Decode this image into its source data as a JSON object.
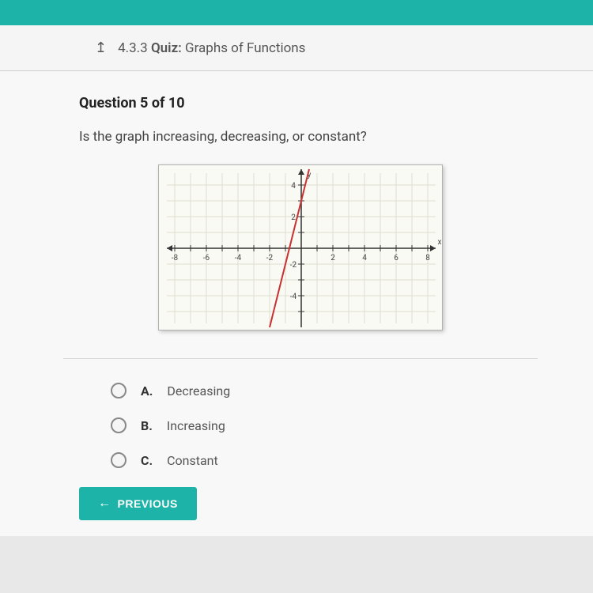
{
  "header": {
    "section_number": "4.3.3",
    "quiz_label": "Quiz:",
    "quiz_title": "Graphs of Functions"
  },
  "question": {
    "number_label": "Question 5 of 10",
    "text": "Is the graph increasing, decreasing, or constant?"
  },
  "chart_data": {
    "type": "line",
    "x": [
      -2,
      0.5
    ],
    "y": [
      -5,
      5
    ],
    "title": "",
    "xlabel": "x",
    "ylabel": "y",
    "xlim": [
      -9,
      9
    ],
    "ylim": [
      -5,
      5
    ],
    "x_ticks": [
      -8,
      -6,
      -4,
      -2,
      2,
      4,
      6,
      8
    ],
    "y_ticks": [
      -4,
      -2,
      2,
      4
    ],
    "grid": true,
    "line_color": "#c93030",
    "slope": 4,
    "intercept": 3
  },
  "options": [
    {
      "letter": "A.",
      "text": "Decreasing"
    },
    {
      "letter": "B.",
      "text": "Increasing"
    },
    {
      "letter": "C.",
      "text": "Constant"
    }
  ],
  "buttons": {
    "previous": "PREVIOUS"
  }
}
